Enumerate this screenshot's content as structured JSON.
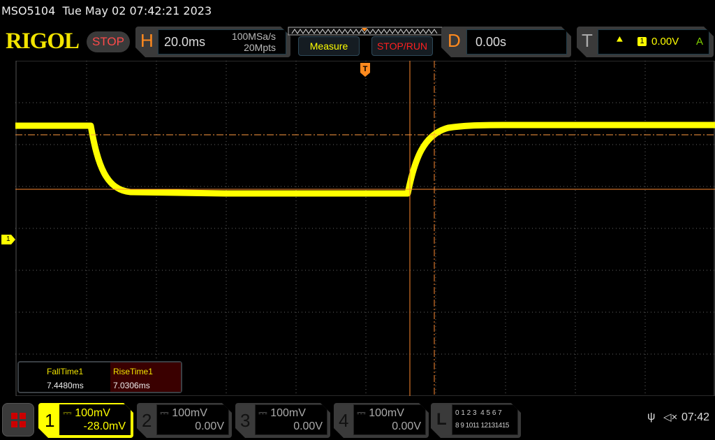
{
  "status_bar": {
    "model": "MSO5104",
    "datetime": "Tue May 02 07:42:21 2023"
  },
  "header": {
    "logo": "RIGOL",
    "run_state": "STOP",
    "horizontal": {
      "letter": "H",
      "timebase": "20.0ms",
      "sample_rate": "100MSa/s",
      "memory_depth": "20Mpts"
    },
    "measure_button": "Measure",
    "stop_run_button": "STOP/RUN",
    "delay": {
      "letter": "D",
      "value": "0.00s"
    },
    "trigger": {
      "letter": "T",
      "source": "1",
      "level": "0.00V",
      "mode": "A"
    }
  },
  "channel1_marker": "1",
  "trigger_marker": "T",
  "measurements": [
    {
      "label": "FallTime1",
      "value": "7.4480ms"
    },
    {
      "label": "RiseTime1",
      "value": "7.0306ms"
    }
  ],
  "channels": [
    {
      "num": "1",
      "scale": "100mV",
      "offset": "-28.0mV",
      "active": true
    },
    {
      "num": "2",
      "scale": "100mV",
      "offset": "0.00V",
      "active": false
    },
    {
      "num": "3",
      "scale": "100mV",
      "offset": "0.00V",
      "active": false
    },
    {
      "num": "4",
      "scale": "100mV",
      "offset": "0.00V",
      "active": false
    }
  ],
  "logic": {
    "letter": "L",
    "row1": "0 1 2 3  4 5 6 7",
    "row2": "8 9 1011 12131415"
  },
  "clock": "07:42",
  "colors": {
    "ch1": "#ffff00",
    "accent": "#ff8a1e",
    "stop": "#ff4a4a"
  }
}
